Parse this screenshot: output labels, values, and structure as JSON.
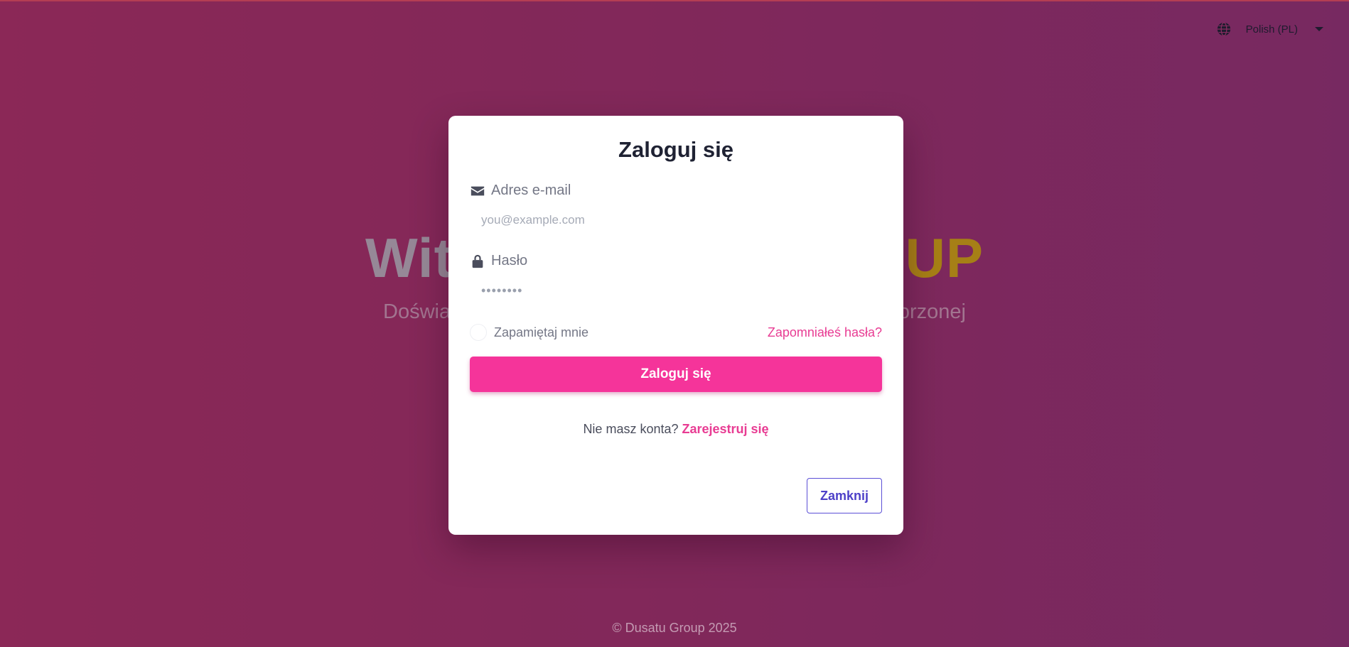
{
  "language": {
    "icon": "globe-icon",
    "selected": "Polish (PL)"
  },
  "hero": {
    "title_left": "Wit",
    "title_right": "OUP",
    "subtitle_left": "Doświa",
    "subtitle_right": "orzonej"
  },
  "login_modal": {
    "title": "Zaloguj się",
    "email": {
      "icon": "envelope-icon",
      "label": "Adres e-mail",
      "placeholder": "you@example.com",
      "value": ""
    },
    "password": {
      "icon": "lock-icon",
      "label": "Hasło",
      "masked_value": "••••••••"
    },
    "remember_label": "Zapamiętaj mnie",
    "remember_checked": false,
    "forgot_link": "Zapomniałeś hasła?",
    "submit_label": "Zaloguj się",
    "no_account_text": "Nie masz konta?",
    "register_link": "Zarejestruj się",
    "close_label": "Zamknij"
  },
  "footer": {
    "copyright": "© Dusatu Group 2025"
  },
  "colors": {
    "accent": "#f5349a",
    "link": "#e83c93",
    "close_border": "#5b4fd6"
  }
}
